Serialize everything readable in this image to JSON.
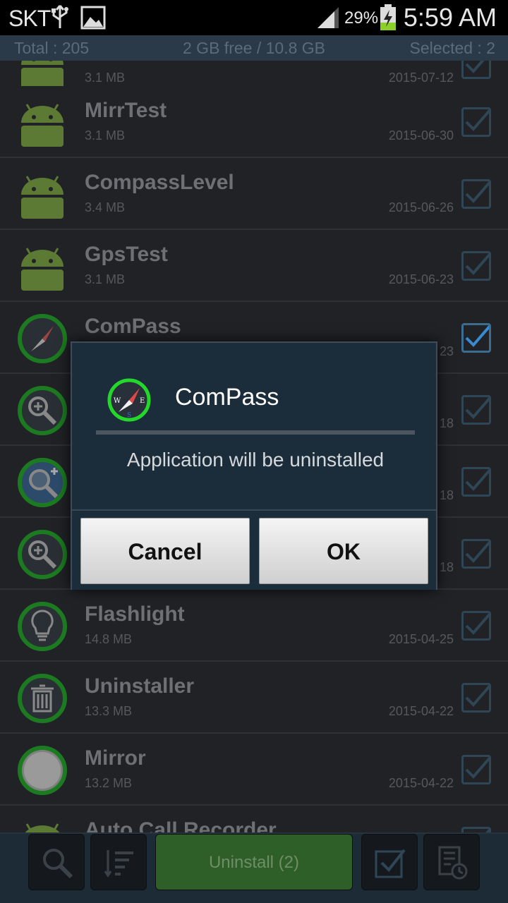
{
  "status_bar": {
    "carrier": "SKT",
    "battery_percent": "29%",
    "time": "5:59 AM"
  },
  "summary": {
    "total": "Total : 205",
    "storage": "2 GB free / 10.8 GB",
    "selected": "Selected : 2"
  },
  "apps": [
    {
      "name": "",
      "size": "3.1 MB",
      "date": "2015-07-12",
      "icon": "android-robot-icon",
      "checked": false
    },
    {
      "name": "MirrTest",
      "size": "3.1 MB",
      "date": "2015-06-30",
      "icon": "android-robot-icon",
      "checked": false
    },
    {
      "name": "CompassLevel",
      "size": "3.4 MB",
      "date": "2015-06-26",
      "icon": "android-robot-icon",
      "checked": false
    },
    {
      "name": "GpsTest",
      "size": "3.1 MB",
      "date": "2015-06-23",
      "icon": "android-robot-icon",
      "checked": false
    },
    {
      "name": "ComPass",
      "size": "",
      "date": "23",
      "icon": "compass-icon",
      "checked": true
    },
    {
      "name": "",
      "size": "",
      "date": "18",
      "icon": "magnifier-icon",
      "checked": false
    },
    {
      "name": "",
      "size": "",
      "date": "18",
      "icon": "magnifier-plus-icon",
      "checked": false
    },
    {
      "name": "",
      "size": "",
      "date": "18",
      "icon": "magnifier-icon",
      "checked": false
    },
    {
      "name": "Flashlight",
      "size": "14.8 MB",
      "date": "2015-04-25",
      "icon": "lightbulb-icon",
      "checked": false
    },
    {
      "name": "Uninstaller",
      "size": "13.3 MB",
      "date": "2015-04-22",
      "icon": "trash-icon",
      "checked": false
    },
    {
      "name": "Mirror",
      "size": "13.2 MB",
      "date": "2015-04-22",
      "icon": "mirror-icon",
      "checked": false
    },
    {
      "name": "Auto Call Recorder",
      "size": "",
      "date": "",
      "icon": "android-robot-icon",
      "checked": false
    }
  ],
  "toolbar": {
    "uninstall_label": "Uninstall (2)"
  },
  "dialog": {
    "title": "ComPass",
    "message": "Application will be uninstalled",
    "cancel_label": "Cancel",
    "ok_label": "OK"
  },
  "colors": {
    "accent_green": "#2f5f28",
    "checkbox_active": "#3b6d90",
    "dialog_bg": "#1b2c3a"
  }
}
